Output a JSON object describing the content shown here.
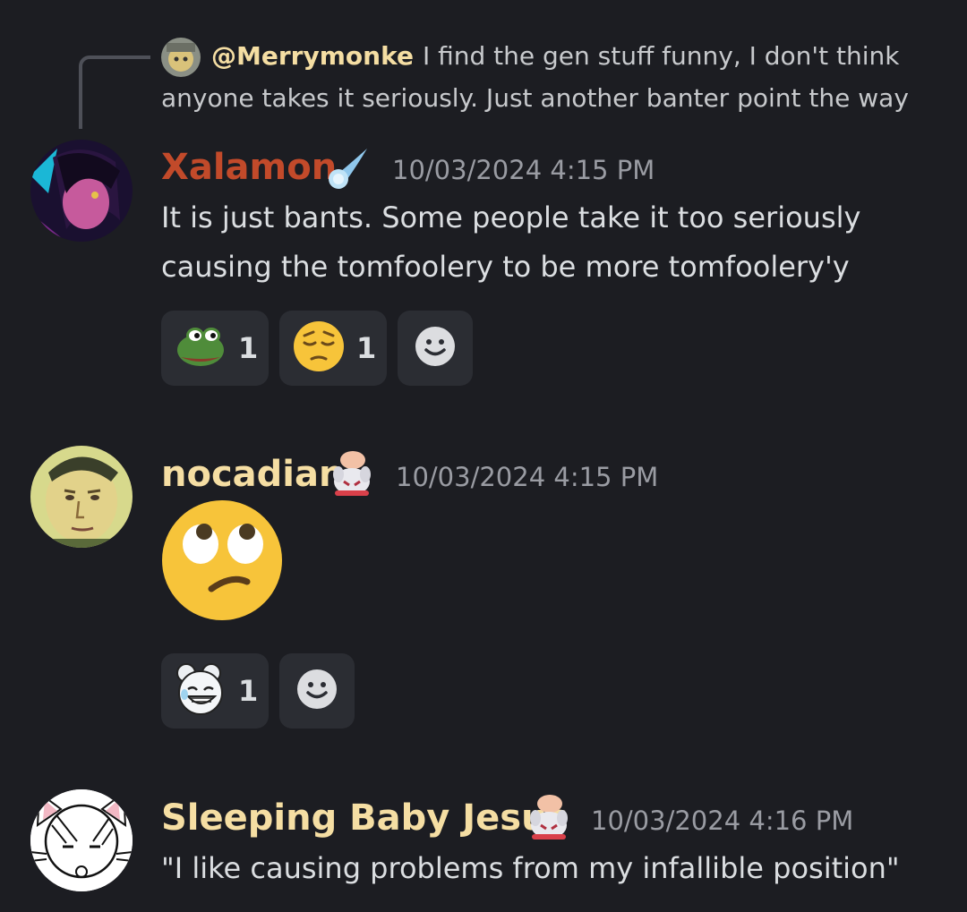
{
  "reply": {
    "mention": "@Merrymonke",
    "line1": "I find the gen stuff funny, I don't think",
    "line2": "anyone takes it seriously. Just another banter point the way"
  },
  "messages": [
    {
      "username": "Xalamon",
      "username_color": "#c24a2a",
      "badge": "comet-icon",
      "timestamp": "10/03/2024 4:15 PM",
      "lines": [
        "It is just bants. Some people take it too seriously",
        "causing the tomfoolery to be more tomfoolery'y"
      ],
      "reactions": [
        {
          "emoji": "pepe-frog-icon",
          "count": "1"
        },
        {
          "emoji": "pensive-face-icon",
          "count": "1"
        }
      ]
    },
    {
      "username": "nocadian",
      "username_color": "#f5dea3",
      "badge": "bunny-hand-icon",
      "timestamp": "10/03/2024 4:15 PM",
      "emoji_message": "eye-roll-face-icon",
      "reactions": [
        {
          "emoji": "laughing-bunny-icon",
          "count": "1"
        }
      ]
    },
    {
      "username": "Sleeping Baby Jesus",
      "username_color": "#f5dea3",
      "badge": "bunny-hand-icon",
      "timestamp": "10/03/2024 4:16 PM",
      "lines": [
        "\"I like causing problems from my infallible position\""
      ]
    }
  ]
}
